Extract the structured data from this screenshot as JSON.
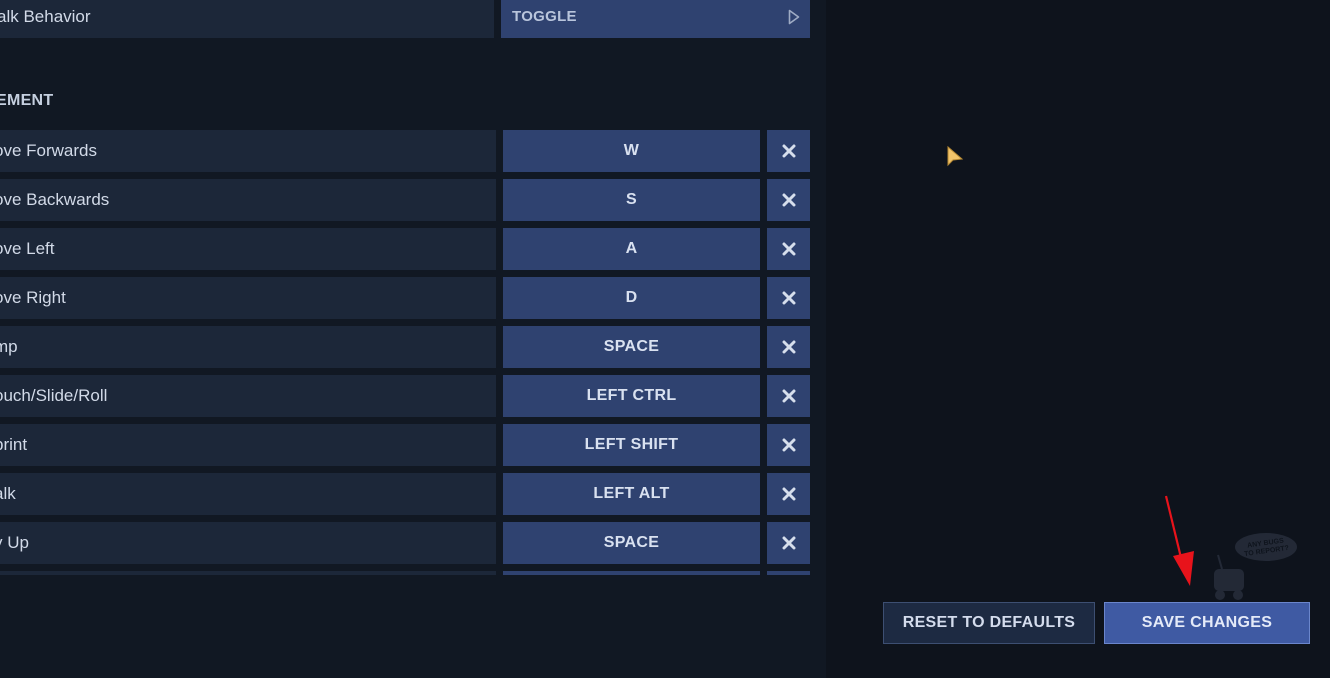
{
  "top_row": {
    "label": "alk Behavior",
    "value": "TOGGLE"
  },
  "section": {
    "title": "VEMENT"
  },
  "bindings": [
    {
      "label": "ove Forwards",
      "key": "W"
    },
    {
      "label": "ove Backwards",
      "key": "S"
    },
    {
      "label": "ove Left",
      "key": "A"
    },
    {
      "label": "ove Right",
      "key": "D"
    },
    {
      "label": "mp",
      "key": "SPACE"
    },
    {
      "label": "ouch/Slide/Roll",
      "key": "LEFT CTRL"
    },
    {
      "label": "print",
      "key": "LEFT SHIFT"
    },
    {
      "label": "alk",
      "key": "LEFT ALT"
    },
    {
      "label": "y Up",
      "key": "SPACE"
    },
    {
      "label": "",
      "key": ""
    }
  ],
  "footer": {
    "reset_label": "RESET TO DEFAULTS",
    "save_label": "SAVE CHANGES"
  },
  "watermark": {
    "text": "ANY BUGS TO REPORT?"
  },
  "colors": {
    "accent": "#2f4270",
    "save": "#3f5aa3",
    "annotation": "#e8131b",
    "cursor": "#f2c46a"
  },
  "icons": {
    "clear": "close-icon",
    "toggle": "play-triangle-icon",
    "cursor": "mouse-cursor-icon",
    "annotation": "red-arrow-icon"
  }
}
